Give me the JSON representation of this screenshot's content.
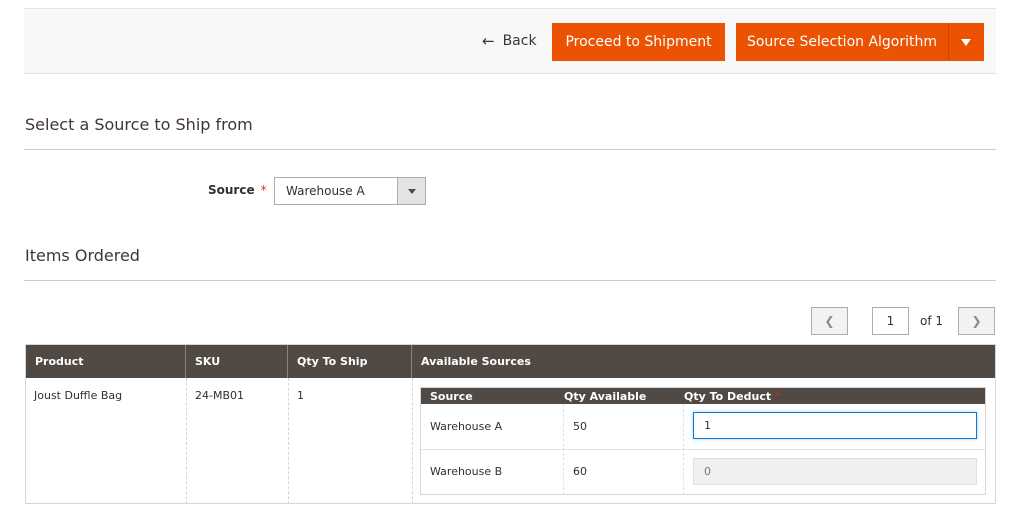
{
  "toolbar": {
    "back_label": "Back",
    "proceed_label": "Proceed to Shipment",
    "ssa_label": "Source Selection Algorithm"
  },
  "source_section": {
    "title": "Select a Source to Ship from",
    "source_label": "Source",
    "required_mark": "*",
    "selected_source": "Warehouse A"
  },
  "items_section": {
    "title": "Items Ordered"
  },
  "pager": {
    "page": "1",
    "of_label": "of 1"
  },
  "grid": {
    "columns": [
      "Product",
      "SKU",
      "Qty To Ship",
      "Available Sources"
    ],
    "rows": [
      {
        "product": "Joust Duffle Bag",
        "sku": "24-MB01",
        "qty_to_ship": "1"
      }
    ]
  },
  "sources_table": {
    "columns": [
      "Source",
      "Qty Available",
      "Qty To Deduct"
    ],
    "required_mark": "*",
    "rows": [
      {
        "source": "Warehouse A",
        "qty_available": "50",
        "qty_to_deduct": "1"
      },
      {
        "source": "Warehouse B",
        "qty_available": "60",
        "qty_to_deduct": "0"
      }
    ]
  },
  "colors": {
    "accent": "#eb5202",
    "grid_header": "#514943",
    "focus": "#007bdb",
    "required": "#e22626"
  },
  "icons": {
    "back": "arrow-left-icon",
    "dropdown": "chevron-down-icon",
    "prev": "chevron-left-icon",
    "next": "chevron-right-icon"
  }
}
